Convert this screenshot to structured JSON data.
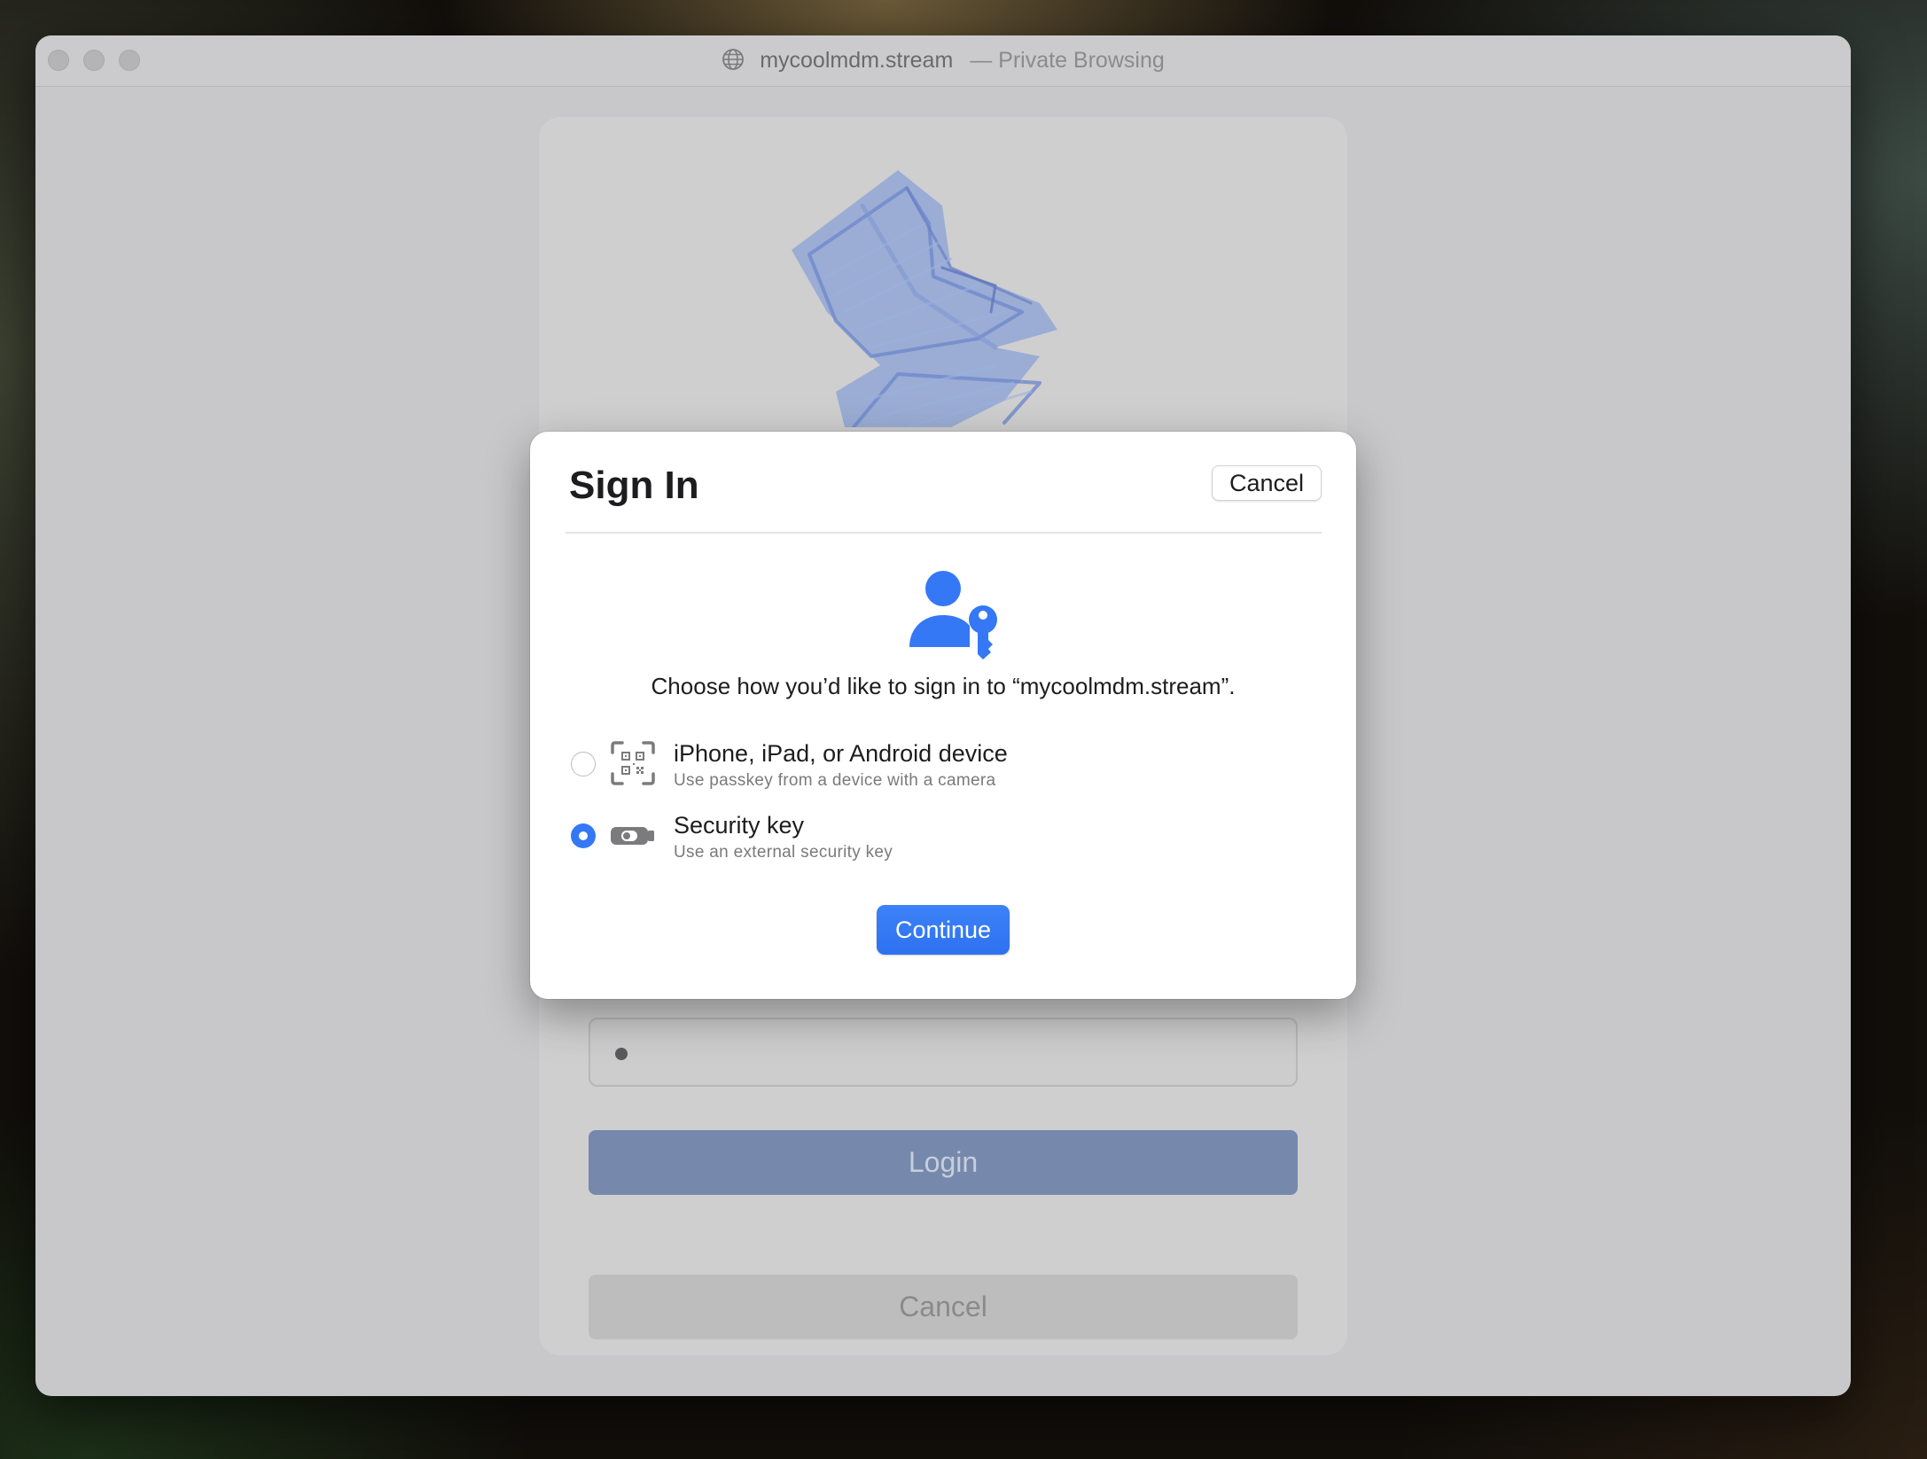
{
  "window": {
    "title_host": "mycoolmdm.stream",
    "title_suffix": "— Private Browsing"
  },
  "background_page": {
    "password_mask": "•",
    "login_label": "Login",
    "cancel_label": "Cancel"
  },
  "dialog": {
    "title": "Sign In",
    "cancel_label": "Cancel",
    "prompt": "Choose how you’d like to sign in to “mycoolmdm.stream”.",
    "options": [
      {
        "label": "iPhone, iPad, or Android device",
        "sublabel": "Use passkey from a device with a camera",
        "icon": "qr-code-scan-icon",
        "selected": false
      },
      {
        "label": "Security key",
        "sublabel": "Use an external security key",
        "icon": "security-key-icon",
        "selected": true
      }
    ],
    "continue_label": "Continue"
  },
  "colors": {
    "accent": "#3478f6",
    "login_button": "#7689ad"
  }
}
